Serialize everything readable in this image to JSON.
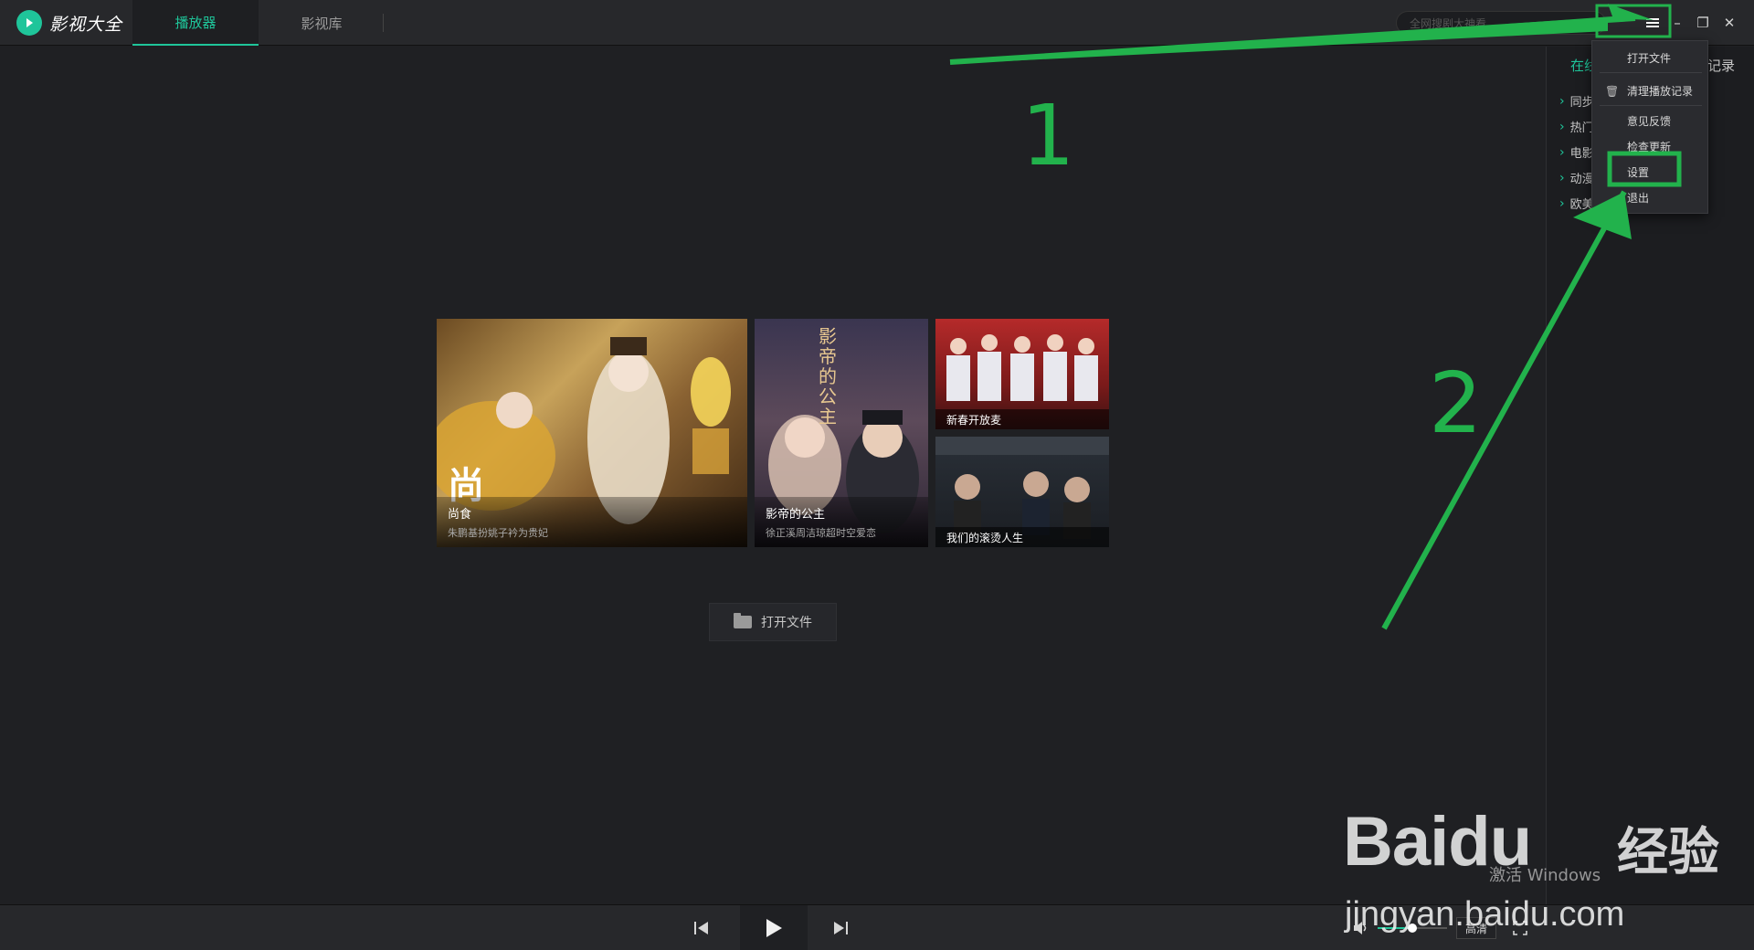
{
  "app": {
    "title": "影视大全",
    "brand_color": "#1fc59a"
  },
  "tabs": [
    {
      "label": "播放器",
      "active": true
    },
    {
      "label": "影视库",
      "active": false
    }
  ],
  "search": {
    "placeholder": "全网搜剧大神看"
  },
  "window_buttons": {
    "menu": "menu-icon",
    "minimize": "–",
    "restore": "❐",
    "close": "✕"
  },
  "dropdown_menu": {
    "items": [
      {
        "label": "打开文件",
        "icon": ""
      },
      {
        "label": "清理播放记录",
        "icon": "trash-icon"
      },
      {
        "label": "意见反馈",
        "icon": ""
      },
      {
        "label": "检查更新",
        "icon": ""
      },
      {
        "label": "设置",
        "icon": ""
      },
      {
        "label": "退出",
        "icon": ""
      }
    ]
  },
  "right_panel": {
    "tabs": [
      "在线",
      "记录"
    ],
    "categories": [
      "同步",
      "热门",
      "电影",
      "动漫",
      "欧美"
    ]
  },
  "posters": {
    "main": {
      "title": "尚食",
      "subtitle": "朱鹏基扮姚子衿为贵妃",
      "overlay_char": "尚"
    },
    "second": {
      "title": "影帝的公主",
      "subtitle": "徐正溪周洁琼超时空爱恋",
      "overlay_text": "影帝的公主"
    },
    "third": {
      "title": "新春开放麦"
    },
    "fourth": {
      "title": "我们的滚烫人生"
    }
  },
  "open_file_button": {
    "label": "打开文件"
  },
  "controls": {
    "prev": "previous-icon",
    "play": "play-icon",
    "next": "next-icon",
    "volume_level": 0.5,
    "quality": "高清",
    "fullscreen": "fullscreen-icon"
  },
  "annotations": {
    "step1": "1",
    "step2": "2",
    "arrow_color": "#22b24c"
  },
  "watermark": {
    "brand": "Baidu",
    "brand_cn": "经验",
    "url": "jingyan.baidu.com",
    "os_notice": "激活 Windows"
  }
}
